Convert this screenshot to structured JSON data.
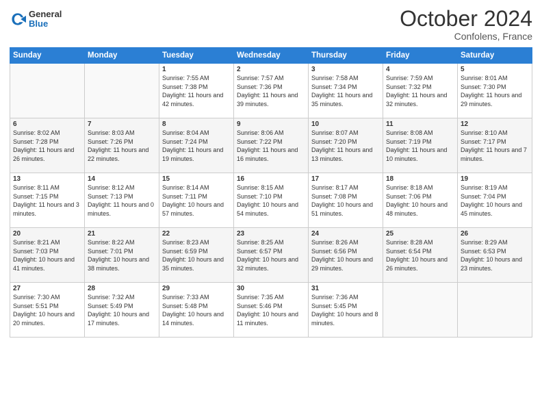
{
  "header": {
    "logo_general": "General",
    "logo_blue": "Blue",
    "month": "October 2024",
    "location": "Confolens, France"
  },
  "days_of_week": [
    "Sunday",
    "Monday",
    "Tuesday",
    "Wednesday",
    "Thursday",
    "Friday",
    "Saturday"
  ],
  "weeks": [
    [
      {
        "day": "",
        "info": ""
      },
      {
        "day": "",
        "info": ""
      },
      {
        "day": "1",
        "info": "Sunrise: 7:55 AM\nSunset: 7:38 PM\nDaylight: 11 hours and 42 minutes."
      },
      {
        "day": "2",
        "info": "Sunrise: 7:57 AM\nSunset: 7:36 PM\nDaylight: 11 hours and 39 minutes."
      },
      {
        "day": "3",
        "info": "Sunrise: 7:58 AM\nSunset: 7:34 PM\nDaylight: 11 hours and 35 minutes."
      },
      {
        "day": "4",
        "info": "Sunrise: 7:59 AM\nSunset: 7:32 PM\nDaylight: 11 hours and 32 minutes."
      },
      {
        "day": "5",
        "info": "Sunrise: 8:01 AM\nSunset: 7:30 PM\nDaylight: 11 hours and 29 minutes."
      }
    ],
    [
      {
        "day": "6",
        "info": "Sunrise: 8:02 AM\nSunset: 7:28 PM\nDaylight: 11 hours and 26 minutes."
      },
      {
        "day": "7",
        "info": "Sunrise: 8:03 AM\nSunset: 7:26 PM\nDaylight: 11 hours and 22 minutes."
      },
      {
        "day": "8",
        "info": "Sunrise: 8:04 AM\nSunset: 7:24 PM\nDaylight: 11 hours and 19 minutes."
      },
      {
        "day": "9",
        "info": "Sunrise: 8:06 AM\nSunset: 7:22 PM\nDaylight: 11 hours and 16 minutes."
      },
      {
        "day": "10",
        "info": "Sunrise: 8:07 AM\nSunset: 7:20 PM\nDaylight: 11 hours and 13 minutes."
      },
      {
        "day": "11",
        "info": "Sunrise: 8:08 AM\nSunset: 7:19 PM\nDaylight: 11 hours and 10 minutes."
      },
      {
        "day": "12",
        "info": "Sunrise: 8:10 AM\nSunset: 7:17 PM\nDaylight: 11 hours and 7 minutes."
      }
    ],
    [
      {
        "day": "13",
        "info": "Sunrise: 8:11 AM\nSunset: 7:15 PM\nDaylight: 11 hours and 3 minutes."
      },
      {
        "day": "14",
        "info": "Sunrise: 8:12 AM\nSunset: 7:13 PM\nDaylight: 11 hours and 0 minutes."
      },
      {
        "day": "15",
        "info": "Sunrise: 8:14 AM\nSunset: 7:11 PM\nDaylight: 10 hours and 57 minutes."
      },
      {
        "day": "16",
        "info": "Sunrise: 8:15 AM\nSunset: 7:10 PM\nDaylight: 10 hours and 54 minutes."
      },
      {
        "day": "17",
        "info": "Sunrise: 8:17 AM\nSunset: 7:08 PM\nDaylight: 10 hours and 51 minutes."
      },
      {
        "day": "18",
        "info": "Sunrise: 8:18 AM\nSunset: 7:06 PM\nDaylight: 10 hours and 48 minutes."
      },
      {
        "day": "19",
        "info": "Sunrise: 8:19 AM\nSunset: 7:04 PM\nDaylight: 10 hours and 45 minutes."
      }
    ],
    [
      {
        "day": "20",
        "info": "Sunrise: 8:21 AM\nSunset: 7:03 PM\nDaylight: 10 hours and 41 minutes."
      },
      {
        "day": "21",
        "info": "Sunrise: 8:22 AM\nSunset: 7:01 PM\nDaylight: 10 hours and 38 minutes."
      },
      {
        "day": "22",
        "info": "Sunrise: 8:23 AM\nSunset: 6:59 PM\nDaylight: 10 hours and 35 minutes."
      },
      {
        "day": "23",
        "info": "Sunrise: 8:25 AM\nSunset: 6:57 PM\nDaylight: 10 hours and 32 minutes."
      },
      {
        "day": "24",
        "info": "Sunrise: 8:26 AM\nSunset: 6:56 PM\nDaylight: 10 hours and 29 minutes."
      },
      {
        "day": "25",
        "info": "Sunrise: 8:28 AM\nSunset: 6:54 PM\nDaylight: 10 hours and 26 minutes."
      },
      {
        "day": "26",
        "info": "Sunrise: 8:29 AM\nSunset: 6:53 PM\nDaylight: 10 hours and 23 minutes."
      }
    ],
    [
      {
        "day": "27",
        "info": "Sunrise: 7:30 AM\nSunset: 5:51 PM\nDaylight: 10 hours and 20 minutes."
      },
      {
        "day": "28",
        "info": "Sunrise: 7:32 AM\nSunset: 5:49 PM\nDaylight: 10 hours and 17 minutes."
      },
      {
        "day": "29",
        "info": "Sunrise: 7:33 AM\nSunset: 5:48 PM\nDaylight: 10 hours and 14 minutes."
      },
      {
        "day": "30",
        "info": "Sunrise: 7:35 AM\nSunset: 5:46 PM\nDaylight: 10 hours and 11 minutes."
      },
      {
        "day": "31",
        "info": "Sunrise: 7:36 AM\nSunset: 5:45 PM\nDaylight: 10 hours and 8 minutes."
      },
      {
        "day": "",
        "info": ""
      },
      {
        "day": "",
        "info": ""
      }
    ]
  ]
}
